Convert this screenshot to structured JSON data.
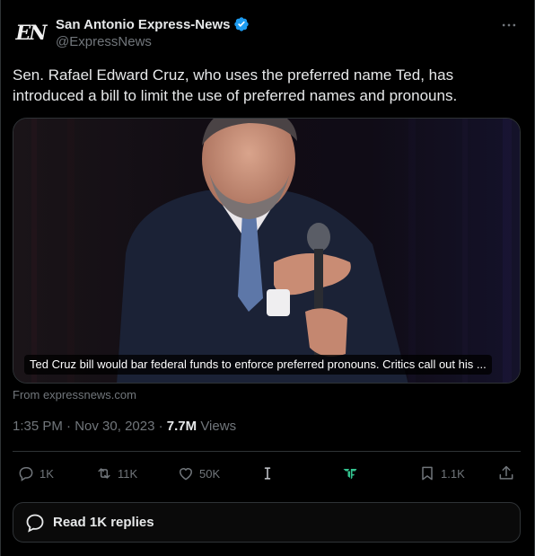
{
  "author": {
    "display_name": "San Antonio Express-News",
    "handle": "@ExpressNews",
    "avatar_text": "EN",
    "verified": true
  },
  "tweet": {
    "text": "Sen. Rafael Edward Cruz, who uses the preferred name Ted, has introduced a bill to limit the use of preferred names and pronouns."
  },
  "card": {
    "caption": "Ted Cruz bill would bar federal funds to enforce preferred pronouns. Critics call out his ...",
    "source": "From expressnews.com"
  },
  "meta": {
    "time": "1:35 PM",
    "separator": " · ",
    "date": "Nov 30, 2023",
    "views_count": "7.7M",
    "views_label": "Views"
  },
  "actions": {
    "replies": "1K",
    "reposts": "11K",
    "likes": "50K",
    "bookmarks": "1.1K"
  },
  "replies_button": {
    "label": "Read 1K replies"
  },
  "colors": {
    "background": "#000000",
    "text": "#e7e9ea",
    "muted": "#71767b",
    "border": "#2f3336",
    "verified": "#1d9bf0",
    "ext_icon": "#33c28e"
  },
  "icons": [
    "verified-badge-icon",
    "more-icon",
    "reply-icon",
    "repost-icon",
    "like-icon",
    "text-cursor-icon",
    "extension-icon",
    "bookmark-icon",
    "share-icon",
    "chat-bubble-icon"
  ]
}
